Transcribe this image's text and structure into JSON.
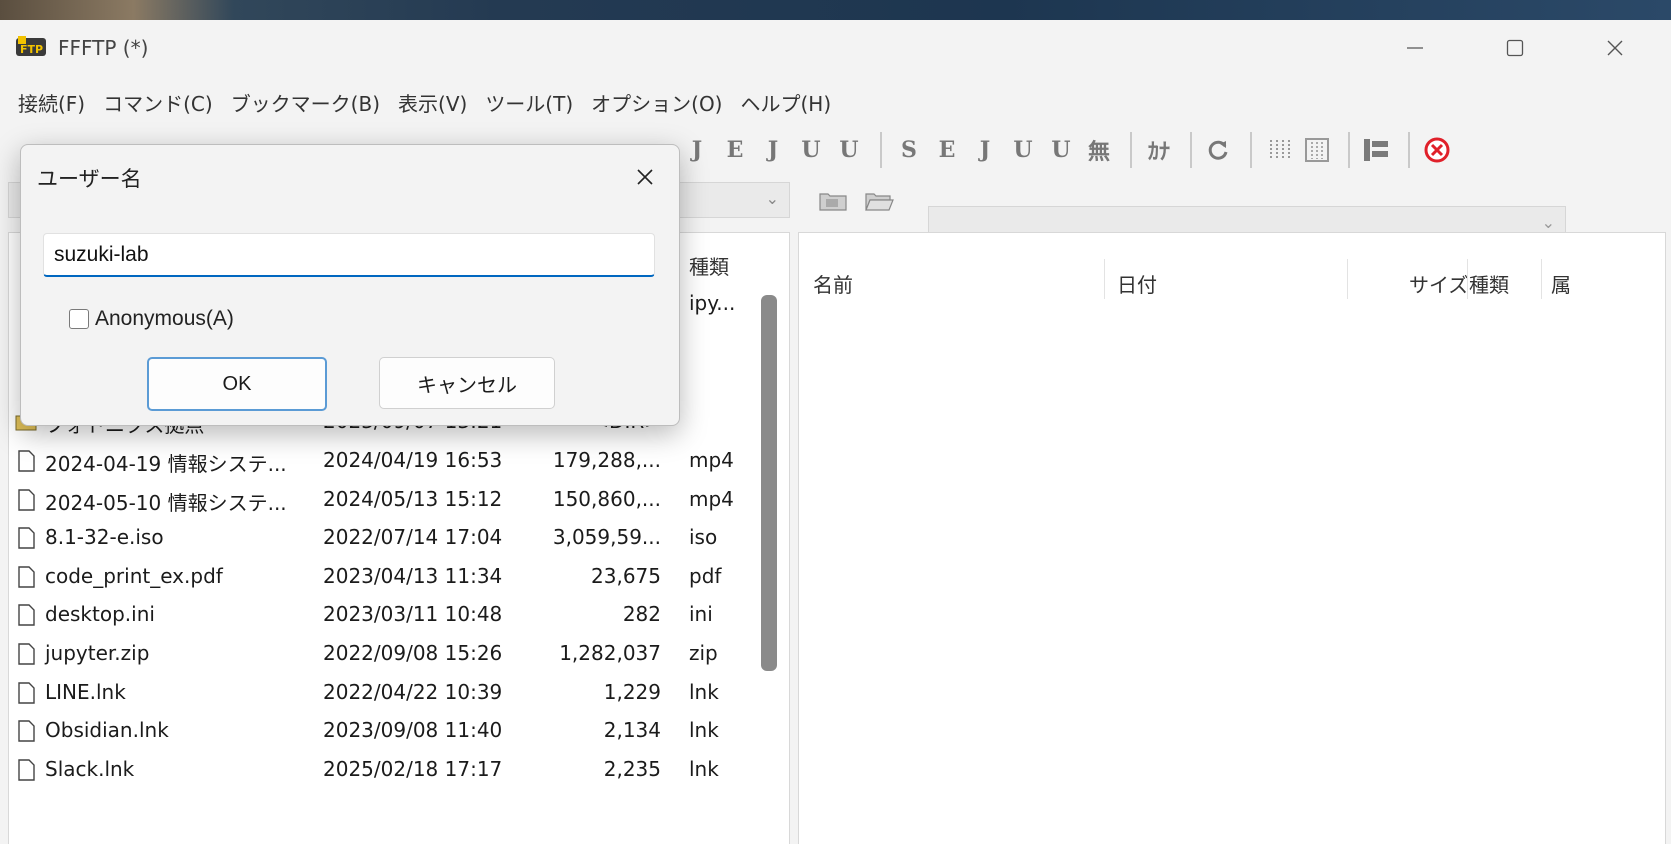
{
  "window": {
    "title": "FFFTP (*)"
  },
  "menubar": [
    {
      "label": "接続(F)"
    },
    {
      "label": "コマンド(C)"
    },
    {
      "label": "ブックマーク(B)"
    },
    {
      "label": "表示(V)"
    },
    {
      "label": "ツール(T)"
    },
    {
      "label": "オプション(O)"
    },
    {
      "label": "ヘルプ(H)"
    }
  ],
  "toolbar": {
    "kanji_left": [
      "J",
      "E",
      "J",
      "U",
      "U"
    ],
    "kanji_right": [
      "S",
      "E",
      "J",
      "U",
      "U",
      "無"
    ],
    "kana": "ｶﾅ"
  },
  "dialog": {
    "title": "ユーザー名",
    "input_value": "suzuki-lab",
    "checkbox_label": "Anonymous(A)",
    "ok_label": "OK",
    "cancel_label": "キャンセル"
  },
  "left_pane": {
    "header_type": "種類",
    "rows": [
      {
        "name": "",
        "date": "",
        "size": "",
        "type": "ipy..."
      },
      {
        "name": "フォトニクス拠点",
        "date": "2023/09/07 13:21",
        "size": "<DIR>",
        "type": "",
        "icon": "folder"
      },
      {
        "name": "2024-04-19 情報システ...",
        "date": "2024/04/19 16:53",
        "size": "179,288,...",
        "type": "mp4",
        "icon": "file"
      },
      {
        "name": "2024-05-10 情報システ...",
        "date": "2024/05/13 15:12",
        "size": "150,860,...",
        "type": "mp4",
        "icon": "file"
      },
      {
        "name": "8.1-32-e.iso",
        "date": "2022/07/14 17:04",
        "size": "3,059,59...",
        "type": "iso",
        "icon": "file"
      },
      {
        "name": "code_print_ex.pdf",
        "date": "2023/04/13 11:34",
        "size": "23,675",
        "type": "pdf",
        "icon": "file"
      },
      {
        "name": "desktop.ini",
        "date": "2023/03/11 10:48",
        "size": "282",
        "type": "ini",
        "icon": "file"
      },
      {
        "name": "jupyter.zip",
        "date": "2022/09/08 15:26",
        "size": "1,282,037",
        "type": "zip",
        "icon": "file"
      },
      {
        "name": "LINE.lnk",
        "date": "2022/04/22 10:39",
        "size": "1,229",
        "type": "lnk",
        "icon": "file"
      },
      {
        "name": "Obsidian.lnk",
        "date": "2023/09/08 11:40",
        "size": "2,134",
        "type": "lnk",
        "icon": "file"
      },
      {
        "name": "Slack.lnk",
        "date": "2025/02/18 17:17",
        "size": "2,235",
        "type": "lnk",
        "icon": "file"
      }
    ]
  },
  "right_pane": {
    "headers": {
      "name": "名前",
      "date": "日付",
      "size": "サイズ",
      "type": "種類",
      "extra": "属"
    }
  }
}
